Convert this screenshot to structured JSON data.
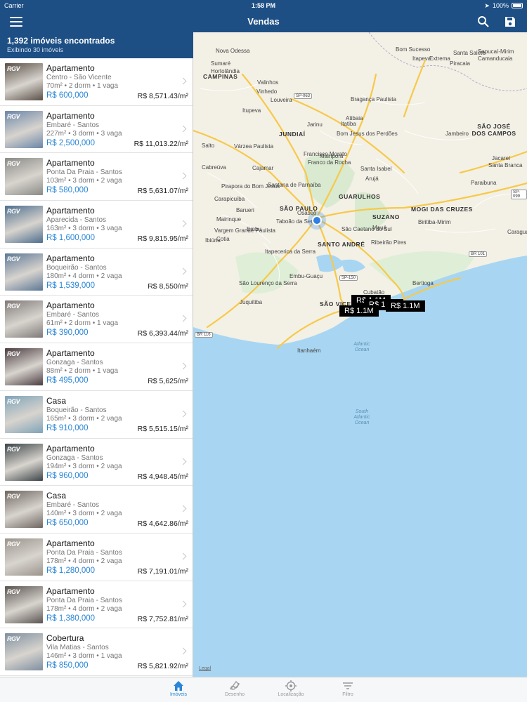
{
  "status_bar": {
    "carrier": "Carrier",
    "time": "1:58 PM",
    "battery": "100%"
  },
  "navbar": {
    "title": "Vendas",
    "menu_icon": "hamburger-menu-icon",
    "search_icon": "search-icon",
    "save_icon": "save-icon"
  },
  "summary": {
    "count": "1,392 imóveis encontrados",
    "shown": "Exibindo 30 imóveis"
  },
  "listings": [
    {
      "type": "Apartamento",
      "location": "Centro - São Vicente",
      "specs": "70m² • 2 dorm • 1 vaga",
      "price": "R$ 600,000",
      "price_m2": "R$ 8,571.43/m²",
      "thumb": "#5a5048"
    },
    {
      "type": "Apartamento",
      "location": "Embaré - Santos",
      "specs": "227m² • 3 dorm • 3 vaga",
      "price": "R$ 2,500,000",
      "price_m2": "R$ 11,013.22/m²",
      "thumb": "#6b86a8"
    },
    {
      "type": "Apartamento",
      "location": "Ponta Da Praia - Santos",
      "specs": "103m² • 3 dorm • 2 vaga",
      "price": "R$ 580,000",
      "price_m2": "R$ 5,631.07/m²",
      "thumb": "#8a8a86"
    },
    {
      "type": "Apartamento",
      "location": "Aparecida - Santos",
      "specs": "163m² • 3 dorm • 3 vaga",
      "price": "R$ 1,600,000",
      "price_m2": "R$ 9,815.95/m²",
      "thumb": "#4e6f8e"
    },
    {
      "type": "Apartamento",
      "location": "Boqueirão - Santos",
      "specs": "180m² • 4 dorm • 2 vaga",
      "price": "R$ 1,539,000",
      "price_m2": "R$ 8,550/m²",
      "thumb": "#5d7896"
    },
    {
      "type": "Apartamento",
      "location": "Embaré - Santos",
      "specs": "61m² • 2 dorm • 1 vaga",
      "price": "R$ 390,000",
      "price_m2": "R$ 6,393.44/m²",
      "thumb": "#7f7a78"
    },
    {
      "type": "Apartamento",
      "location": "Gonzaga - Santos",
      "specs": "88m² • 2 dorm • 1 vaga",
      "price": "R$ 495,000",
      "price_m2": "R$ 5,625/m²",
      "thumb": "#4a3c40"
    },
    {
      "type": "Casa",
      "location": "Boqueirão - Santos",
      "specs": "165m² • 3 dorm • 2 vaga",
      "price": "R$ 910,000",
      "price_m2": "R$ 5,515.15/m²",
      "thumb": "#7fa3b8"
    },
    {
      "type": "Apartamento",
      "location": "Gonzaga - Santos",
      "specs": "194m² • 3 dorm • 2 vaga",
      "price": "R$ 960,000",
      "price_m2": "R$ 4,948.45/m²",
      "thumb": "#3c4548"
    },
    {
      "type": "Casa",
      "location": "Embaré - Santos",
      "specs": "140m² • 3 dorm • 2 vaga",
      "price": "R$ 650,000",
      "price_m2": "R$ 4,642.86/m²",
      "thumb": "#6f6660"
    },
    {
      "type": "Apartamento",
      "location": "Ponta Da Praia - Santos",
      "specs": "178m² • 4 dorm • 2 vaga",
      "price": "R$ 1,280,000",
      "price_m2": "R$ 7,191.01/m²",
      "thumb": "#9a948c"
    },
    {
      "type": "Apartamento",
      "location": "Ponta Da Praia - Santos",
      "specs": "178m² • 4 dorm • 2 vaga",
      "price": "R$ 1,380,000",
      "price_m2": "R$ 7,752.81/m²",
      "thumb": "#5a5450"
    },
    {
      "type": "Cobertura",
      "location": "Vila Matias - Santos",
      "specs": "146m² • 3 dorm • 1 vaga",
      "price": "R$ 850,000",
      "price_m2": "R$ 5,821.92/m²",
      "thumb": "#7e8fa0"
    }
  ],
  "thumb_logo": "RGV",
  "map": {
    "cities_major": [
      "CAMPINAS",
      "JUNDIAÍ",
      "SÃO PAULO",
      "GUARULHOS",
      "SANTO ANDRÉ",
      "SUZANO",
      "MOGI DAS CRUZES",
      "SÃO JOSÉ DOS CAMPOS",
      "SÃO VICENTE"
    ],
    "cities_minor": [
      "Nova Odessa",
      "Sumaré",
      "Hortolândia",
      "Valinhos",
      "Vinhedo",
      "Louveira",
      "Itatiba",
      "Atibaia",
      "Bragança Paulista",
      "Itupeva",
      "Jarinu",
      "Bom Jesus dos Perdões",
      "Salto",
      "Várzea Paulista",
      "Francisco Morato",
      "Franco da Rocha",
      "Mairiporã",
      "Cabreúva",
      "Cajamar",
      "Santa Isabel",
      "Arujá",
      "Jacareí",
      "Pirapora do Bom Jesus",
      "Santana de Parnaíba",
      "Carapicuíba",
      "Barueri",
      "Osasco",
      "Embu",
      "Taboão da Serra",
      "São Caetano do Sul",
      "Mauá",
      "Ribeirão Pires",
      "Biritiba-Mirim",
      "Mairinque",
      "Vargem Grande Paulista",
      "Cotia",
      "Ibiúna",
      "Itapecerica da Serra",
      "Embu-Guaçu",
      "Santa Branca",
      "Paraibuna",
      "Cubatão",
      "Bertioga",
      "São Lourenço da Serra",
      "Juquitiba",
      "Itanhaém",
      "Caraguatatuba",
      "Sapucaí-Mirim",
      "Camanducaia",
      "Itapeva",
      "Extrema",
      "Bom Sucesso",
      "Piracaia",
      "Jambeiro",
      "Santa Salete"
    ],
    "ocean_labels": [
      "Atlantic Ocean",
      "South Atlantic Ocean"
    ],
    "road_signs": [
      "SP-063",
      "SP-099",
      "BR 101",
      "SP-150",
      "BR 116"
    ],
    "price_pins": [
      "R$ 1.1M",
      "R$ 1.1M",
      "R$ 1.1M",
      "R$ 1.1M"
    ],
    "legal": "Legal"
  },
  "tabs": [
    {
      "label": "Imóveis",
      "icon": "home-icon",
      "active": true
    },
    {
      "label": "Desenho",
      "icon": "draw-icon",
      "active": false
    },
    {
      "label": "Localização",
      "icon": "location-target-icon",
      "active": false
    },
    {
      "label": "Filtro",
      "icon": "filter-icon",
      "active": false
    }
  ],
  "colors": {
    "navbar": "#1d4f85",
    "price": "#2a86d6",
    "water": "#a8d6f2",
    "land": "#f3f0e6",
    "road": "#f7c948",
    "pin": "#000000"
  }
}
